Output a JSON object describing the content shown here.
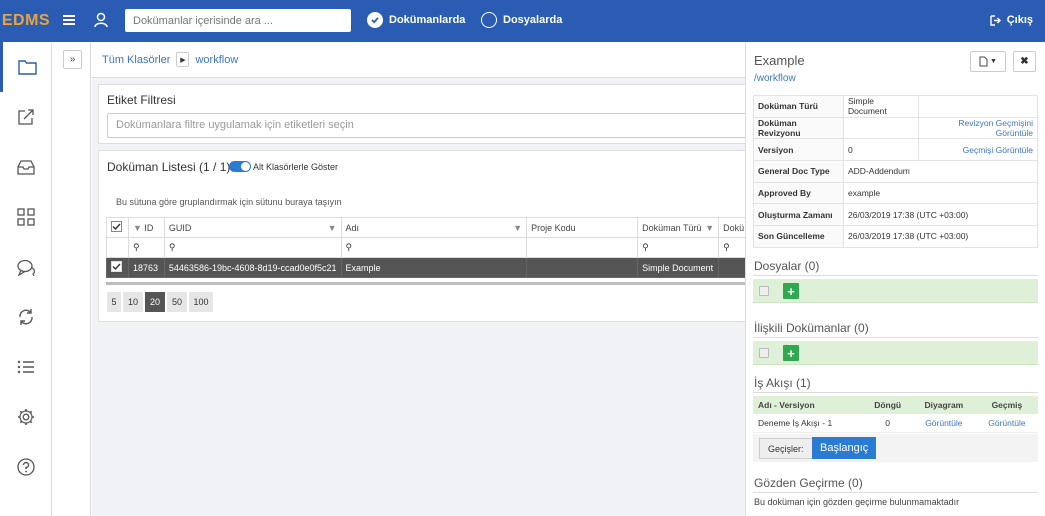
{
  "header": {
    "logo": "EDMS",
    "search_placeholder": "Dokümanlar içerisinde ara ...",
    "scope_documents": "Dokümanlarda",
    "scope_files": "Dosyalarda",
    "logout": "Çıkış"
  },
  "sidebar": {
    "items": [
      "folder-icon",
      "share-icon",
      "inbox-icon",
      "grid-icon",
      "chat-icon",
      "sync-icon",
      "list-icon",
      "gear-icon",
      "help-icon"
    ]
  },
  "breadcrumb": {
    "root": "Tüm Klasörler",
    "current": "workflow"
  },
  "tag_filter": {
    "title": "Etiket Filtresi",
    "placeholder": "Dokümanlara filtre uygulamak için etiketleri seçin"
  },
  "doc_list": {
    "title": "Doküman Listesi (1 / 1)",
    "toggle_label": "Alt Klasörlerle Göster",
    "group_hint": "Bu sütuna göre gruplandırmak için sütunu buraya taşıyın",
    "columns": [
      "ID",
      "GUID",
      "Adı",
      "Proje Kodu",
      "Doküman Türü",
      "Dokü"
    ],
    "rows": [
      {
        "id": "18763",
        "guid": "54463586-19bc-4608-8d19-ccad0e0f5c21",
        "name": "Example",
        "project_code": "",
        "doc_type": "Simple Document",
        "extra": ""
      }
    ],
    "page_sizes": [
      "5",
      "10",
      "20",
      "50",
      "100"
    ],
    "active_page_size": "20"
  },
  "detail": {
    "title": "Example",
    "path": "/workflow",
    "properties": [
      {
        "key": "Doküman Türü",
        "value": "Simple Document",
        "link": ""
      },
      {
        "key": "Doküman Revizyonu",
        "value": "",
        "link": "Revizyon Geçmişini Görüntüle"
      },
      {
        "key": "Versiyon",
        "value": "0",
        "link": "Geçmişi Görüntüle"
      },
      {
        "key": "General Doc Type",
        "value": "ADD-Addendum",
        "link": ""
      },
      {
        "key": "Approved By",
        "value": "example",
        "link": ""
      },
      {
        "key": "Oluşturma Zamanı",
        "value": "26/03/2019 17:38 (UTC +03:00)",
        "link": ""
      },
      {
        "key": "Son Güncelleme",
        "value": "26/03/2019 17:38 (UTC +03:00)",
        "link": ""
      }
    ],
    "files_title": "Dosyalar (0)",
    "related_title": "İlişkili Dokümanlar (0)",
    "workflow_title": "İş Akışı (1)",
    "workflow_columns": [
      "Adı - Versiyon",
      "Döngü",
      "Diyagram",
      "Geçmiş"
    ],
    "workflow_rows": [
      {
        "name": "Deneme İş Akışı - 1",
        "cycle": "0",
        "diagram": "Görüntüle",
        "history": "Görüntüle"
      }
    ],
    "transitions_label": "Geçişler:",
    "start_button": "Başlangıç",
    "review_title": "Gözden Geçirme (0)",
    "review_empty": "Bu doküman için gözden geçirme bulunmamaktadır"
  }
}
